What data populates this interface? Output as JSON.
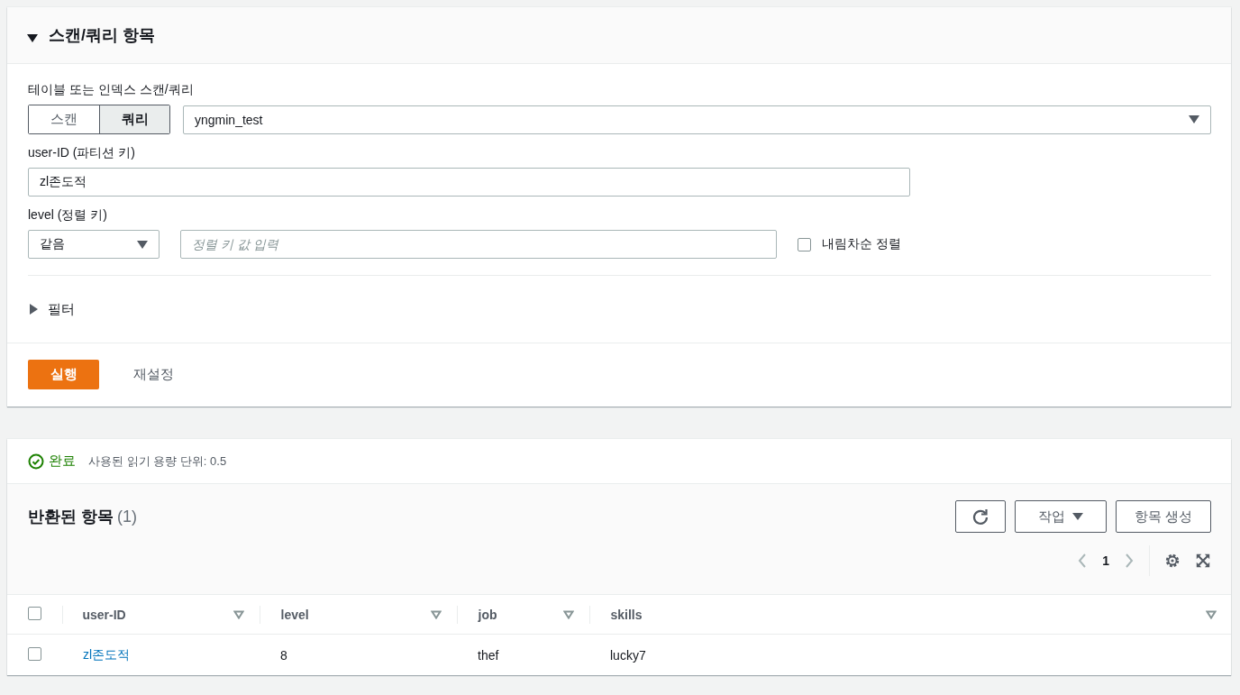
{
  "section": {
    "title": "스캔/쿼리 항목",
    "expanded": true
  },
  "source_label": "테이블 또는 인덱스 스캔/쿼리",
  "modes": [
    {
      "label": "스캔",
      "selected": false
    },
    {
      "label": "쿼리",
      "selected": true
    }
  ],
  "table_select": {
    "value": "yngmin_test"
  },
  "partition_key": {
    "label": "user-ID (파티션 키)",
    "value": "zl존도적"
  },
  "sort_key": {
    "label": "level (정렬 키)",
    "operator": "같음",
    "placeholder": "정렬 키 값 입력"
  },
  "descending": {
    "label": "내림차순 정렬",
    "checked": false
  },
  "filter": {
    "label": "필터",
    "expanded": false
  },
  "actions": {
    "run": "실행",
    "reset": "재설정"
  },
  "status": {
    "label": "완료",
    "detail": "사용된 읽기 용량 단위: 0.5"
  },
  "results": {
    "title": "반환된 항목",
    "count": "(1)",
    "actions_label": "작업",
    "create_label": "항목 생성",
    "page": "1",
    "all_selected": false,
    "columns": [
      "user-ID",
      "level",
      "job",
      "skills"
    ],
    "rows": [
      {
        "selected": false,
        "cells": [
          "zl존도적",
          "8",
          "thef",
          "lucky7"
        ]
      }
    ]
  }
}
